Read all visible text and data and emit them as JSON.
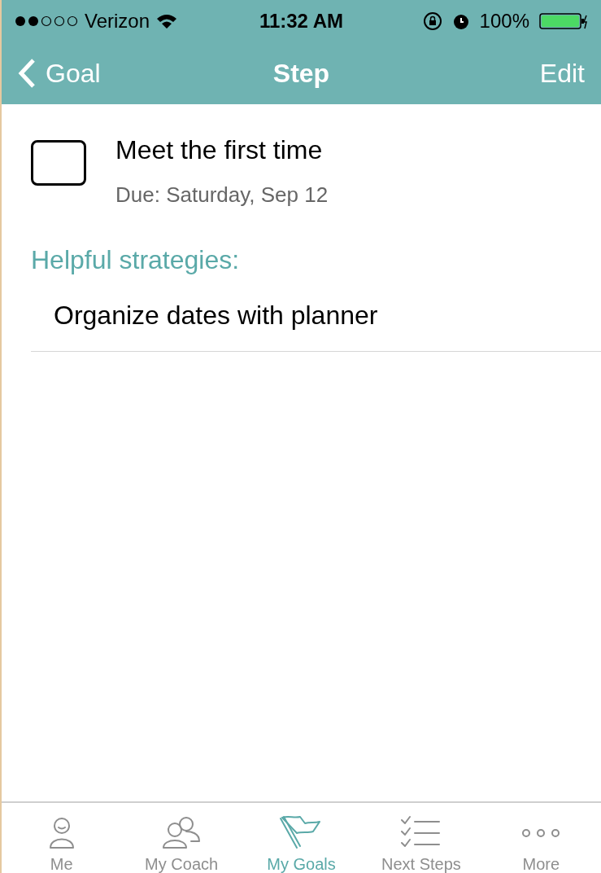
{
  "status_bar": {
    "carrier": "Verizon",
    "time": "11:32 AM",
    "battery": "100%"
  },
  "nav": {
    "back": "Goal",
    "title": "Step",
    "action": "Edit"
  },
  "step": {
    "title": "Meet the first time",
    "due": "Due: Saturday, Sep 12",
    "checked": false
  },
  "strategies": {
    "heading": "Helpful strategies:",
    "items": [
      "Organize dates with planner"
    ]
  },
  "tabs": [
    {
      "label": "Me",
      "kind": "person",
      "selected": false
    },
    {
      "label": "My Coach",
      "kind": "people",
      "selected": false
    },
    {
      "label": "My Goals",
      "kind": "flag",
      "selected": true
    },
    {
      "label": "Next Steps",
      "kind": "checklist",
      "selected": false
    },
    {
      "label": "More",
      "kind": "more",
      "selected": false
    }
  ]
}
